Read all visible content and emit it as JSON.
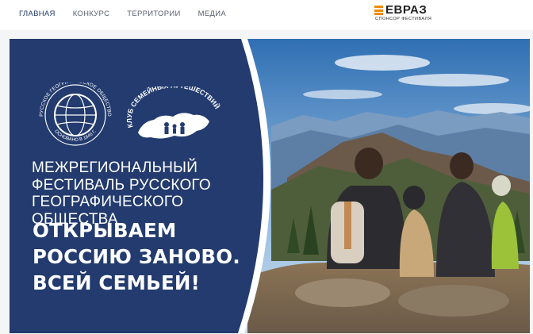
{
  "nav": {
    "items": [
      {
        "label": "ГЛАВНАЯ",
        "active": true
      },
      {
        "label": "КОНКУРС"
      },
      {
        "label": "ТЕРРИТОРИИ"
      },
      {
        "label": "МЕДИА"
      }
    ]
  },
  "sponsor": {
    "name": "ЕВРАЗ",
    "subtitle": "СПОНСОР ФЕСТИВАЛЯ",
    "brand_color": "#f18a00"
  },
  "banner": {
    "rgs_logo": {
      "ring_text": "РУССКОЕ ГЕОГРАФИЧЕСКОЕ ОБЩЕСТВО",
      "founded_text": "ОСНОВАНО В 1845 Г.",
      "icon": "globe-icon"
    },
    "club_logo": {
      "text": "КЛУБ СЕМЕЙНЫХ ПУТЕШЕСТВИЙ",
      "icon": "russia-map-family-icon"
    },
    "headline": "МЕЖРЕГИОНАЛЬНЫЙ\nФЕСТИВАЛЬ РУССКОГО\nГЕОГРАФИЧЕСКОГО ОБЩЕСТВА",
    "slogan": "ОТКРЫВАЕМ\nРОССИЮ ЗАНОВО.\nВСЕЙ СЕМЬЕЙ!",
    "panel_color": "#233b6e",
    "photo_description_icon": "family-mountains-photo"
  }
}
